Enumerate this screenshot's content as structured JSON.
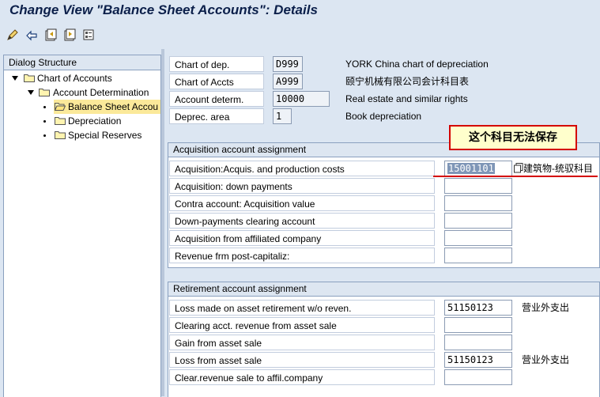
{
  "window": {
    "title": "Change View \"Balance Sheet Accounts\": Details"
  },
  "toolbar": {
    "icons": [
      "display-change-icon",
      "other-entry-icon",
      "previous-entry-icon",
      "next-entry-icon",
      "variable-list-icon"
    ]
  },
  "dialog_structure": {
    "header": "Dialog Structure",
    "items": [
      {
        "label": "Chart of Accounts"
      },
      {
        "label": "Account Determination"
      },
      {
        "label": "Balance Sheet Accou"
      },
      {
        "label": "Depreciation"
      },
      {
        "label": "Special Reserves"
      }
    ]
  },
  "header_fields": [
    {
      "label": "Chart of dep.",
      "value": "D999",
      "desc": "YORK China chart of depreciation"
    },
    {
      "label": "Chart of Accts",
      "value": "A999",
      "desc": "颐宁机械有限公司会计科目表"
    },
    {
      "label": "Account determ.",
      "value": "10000",
      "desc": "Real estate and similar rights"
    },
    {
      "label": "Deprec. area",
      "value": "1",
      "desc": "Book depreciation"
    }
  ],
  "acquisition": {
    "title": "Acquisition account assignment",
    "rows": [
      {
        "label": "Acquisition:Acquis. and production costs",
        "value": "15001101",
        "desc": "建筑物-统驭科目"
      },
      {
        "label": "Acquisition: down payments",
        "value": "",
        "desc": ""
      },
      {
        "label": "Contra account: Acquisition value",
        "value": "",
        "desc": ""
      },
      {
        "label": "Down-payments clearing account",
        "value": "",
        "desc": ""
      },
      {
        "label": "Acquisition from affiliated company",
        "value": "",
        "desc": ""
      },
      {
        "label": "Revenue frm post-capitaliz:",
        "value": "",
        "desc": ""
      }
    ]
  },
  "retirement": {
    "title": "Retirement account assignment",
    "rows": [
      {
        "label": "Loss made on asset retirement w/o reven.",
        "value": "51150123",
        "desc": "营业外支出"
      },
      {
        "label": "Clearing acct. revenue from asset sale",
        "value": "",
        "desc": ""
      },
      {
        "label": "Gain from asset sale",
        "value": "",
        "desc": ""
      },
      {
        "label": "Loss from asset sale",
        "value": "51150123",
        "desc": "营业外支出"
      },
      {
        "label": "Clear.revenue sale to affil.company",
        "value": "",
        "desc": ""
      }
    ]
  },
  "annotation": {
    "text": "这个科目无法保存",
    "color": "#d40000"
  }
}
